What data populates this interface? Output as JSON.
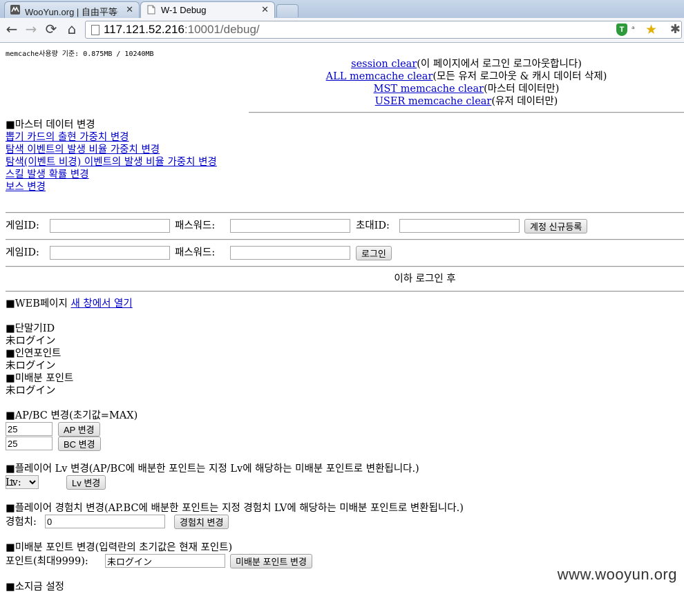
{
  "browser": {
    "tabs": [
      {
        "title": "WooYun.org | 自由平等开",
        "active": false
      },
      {
        "title": "W-1 Debug",
        "active": true
      }
    ],
    "url_host": "117.121.52.216",
    "url_rest": ":10001/debug/",
    "extension_shield_label": "T",
    "translate_label": "ᵃ",
    "icons": {
      "back": "back-arrow-icon",
      "forward": "forward-arrow-icon",
      "reload": "reload-icon",
      "home": "home-icon",
      "star": "bookmark-star-icon",
      "wrench": "wrench-icon"
    }
  },
  "memcache_usage": "memcache사용량 기준: 0.875MB / 10240MB",
  "clear_links": [
    {
      "link": "session clear",
      "desc": "(이 페이지에서 로그인 로그아웃합니다)"
    },
    {
      "link": "ALL memcache clear",
      "desc": "(모든 유저 로그아웃 & 캐시 데이터 삭제)"
    },
    {
      "link": "MST memcache clear",
      "desc": "(마스터 데이터만)"
    },
    {
      "link": "USER memcache clear",
      "desc": "(유저 데이터만)"
    }
  ],
  "master": {
    "heading": "■마스터 데이터 변경",
    "links": [
      "뽑기 카드의 출현 가중치 변경",
      "탐색 이벤트의 발생 비율 가중치 변경",
      "탐색(이벤트 비경) 이벤트의 발생 비율 가중치 변경",
      "스킬 발생 확률 변경",
      "보스 변경"
    ]
  },
  "register_form": {
    "id_label": "게임ID:",
    "pw_label": "패스워드:",
    "invite_label": "초대ID:",
    "id_value": "",
    "pw_value": "",
    "invite_value": "",
    "button": "계정 신규등록"
  },
  "login_form": {
    "id_label": "게임ID:",
    "pw_label": "패스워드:",
    "id_value": "",
    "pw_value": "",
    "button": "로그인"
  },
  "after_login": "이하 로그인 후",
  "web_page": {
    "prefix": "■WEB페이지 ",
    "link": "새 창에서 열기"
  },
  "status": [
    {
      "heading": "■단말기ID",
      "value": "未ログイン"
    },
    {
      "heading": "■인연포인트",
      "value": "未ログイン"
    },
    {
      "heading": "■미배분 포인트",
      "value": "未ログイン"
    }
  ],
  "apbc": {
    "heading": "■AP/BC 변경(초기값=MAX)",
    "ap_value": "25",
    "ap_button": "AP 변경",
    "bc_value": "25",
    "bc_button": "BC 변경"
  },
  "level": {
    "heading": "■플레이어 Lv 변경(AP/BC에 배분한 포인트는 지정 Lv에 해당하는 미배분 포인트로 변환됩니다.)",
    "label": "Lv:",
    "selected": "1",
    "button": "Lv 변경"
  },
  "exp": {
    "heading": "■플레이어 경험치 변경(AP.BC에 배분한 포인트는 지정 경험치 LV에 해당하는 미배분 포인트로 변환됩니다.)",
    "label": "경험치:",
    "value": "0",
    "button": "경험치 변경"
  },
  "unalloc": {
    "heading": "■미배분 포인트 변경(입력란의 초기값은 현재 포인트)",
    "label": "포인트(최대9999):",
    "value": "未ログイン",
    "button": "미배분 포인트 변경"
  },
  "money": {
    "heading": "■소지금 설정"
  },
  "watermark": "www.wooyun.org"
}
